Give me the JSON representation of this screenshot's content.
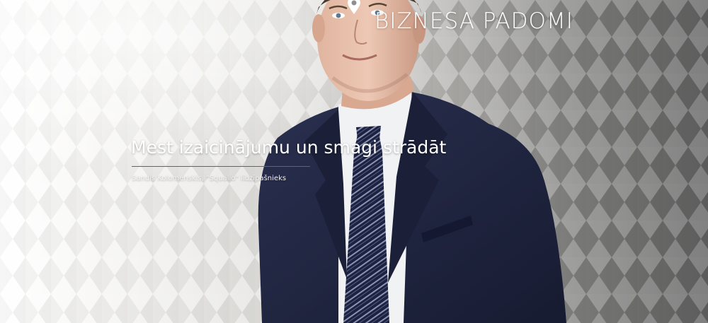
{
  "brand": {
    "title": "BIZNESA PADOMI",
    "icon": "map-pin-icon",
    "color": "#ffffff"
  },
  "article": {
    "headline": "Mest izaicinājumu un smagi strādāt",
    "byline": "Sandis Kolomenskis, \"Squalio\" līdzīpašnieks",
    "accent_color": "#c73a3c"
  }
}
